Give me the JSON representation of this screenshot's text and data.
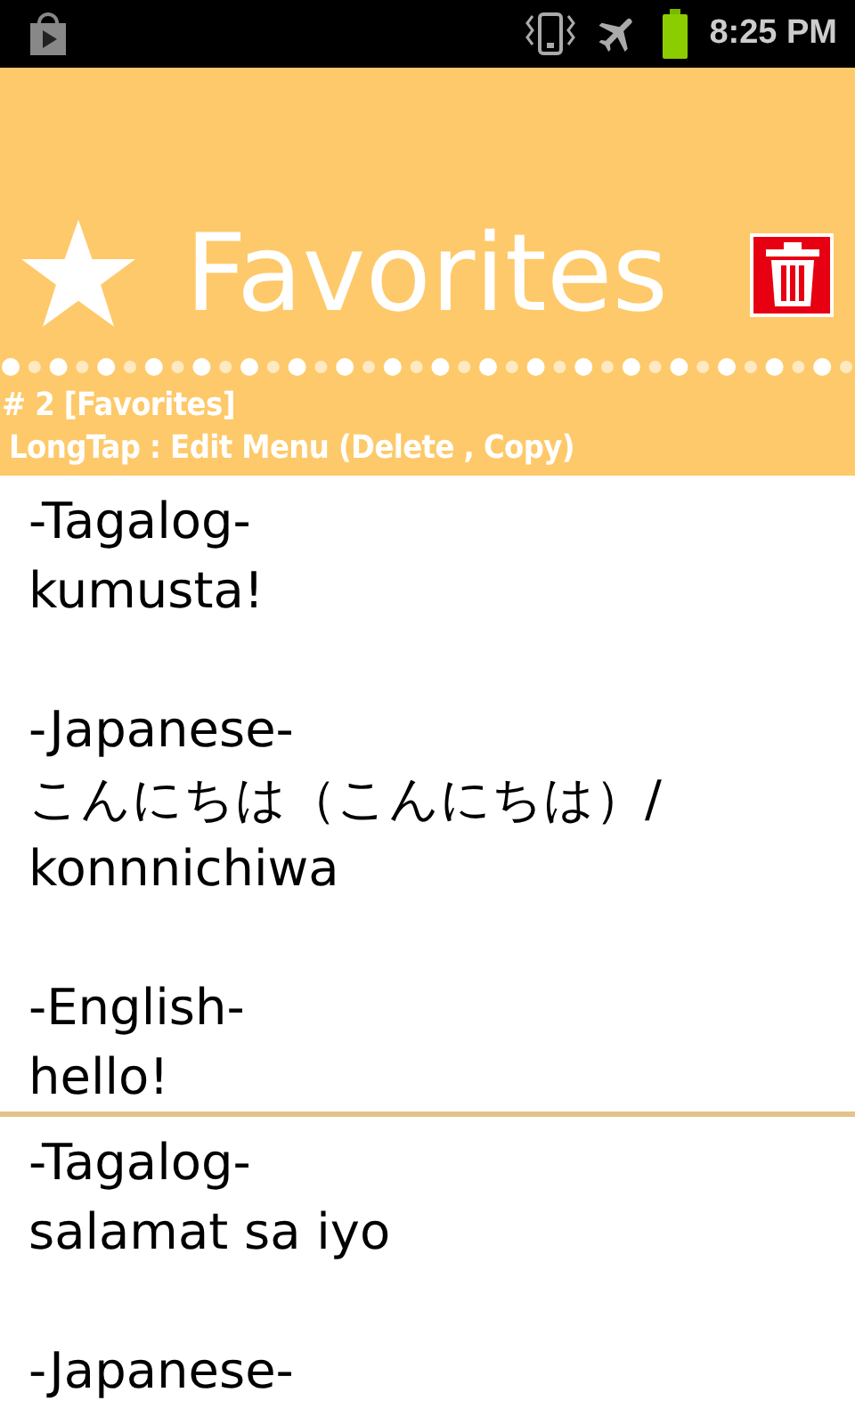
{
  "status_bar": {
    "time": "8:25 PM"
  },
  "header": {
    "title": "Favorites",
    "count": "# 2 [Favorites]",
    "hint": "LongTap : Edit Menu (Delete , Copy)"
  },
  "entries": [
    {
      "sections": [
        {
          "language": "-Tagalog-",
          "phrase": "kumusta!"
        },
        {
          "language": "-Japanese-",
          "phrase": "こんにちは（こんにちは）/ konnnichiwa"
        },
        {
          "language": "-English-",
          "phrase": "hello!"
        }
      ]
    },
    {
      "sections": [
        {
          "language": "-Tagalog-",
          "phrase": "salamat sa iyo"
        },
        {
          "language": "-Japanese-"
        }
      ]
    }
  ]
}
